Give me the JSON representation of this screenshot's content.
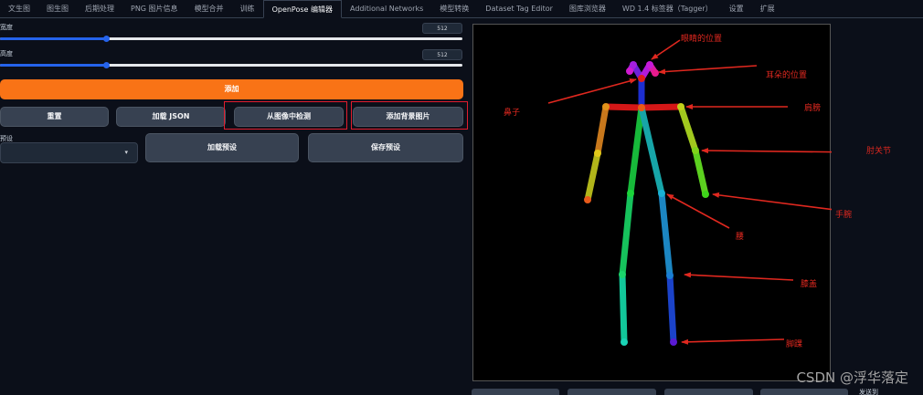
{
  "tabs": [
    {
      "label": "文生图"
    },
    {
      "label": "图生图"
    },
    {
      "label": "后期处理"
    },
    {
      "label": "PNG 图片信息"
    },
    {
      "label": "模型合并"
    },
    {
      "label": "训练"
    },
    {
      "label": "OpenPose 编辑器"
    },
    {
      "label": "Additional Networks"
    },
    {
      "label": "模型转换"
    },
    {
      "label": "Dataset Tag Editor"
    },
    {
      "label": "图库浏览器"
    },
    {
      "label": "WD 1.4 标签器（Tagger）"
    },
    {
      "label": "设置"
    },
    {
      "label": "扩展"
    }
  ],
  "active_tab_index": 6,
  "width": {
    "label": "宽度",
    "value": "512",
    "level": 0.23
  },
  "height": {
    "label": "高度",
    "value": "512",
    "level": 0.23
  },
  "buttons": {
    "add": "添加",
    "reset": "重置",
    "load_json": "加载 JSON",
    "detect_from_image": "从图像中检测",
    "add_background": "添加背景图片",
    "load_preset": "加载预设",
    "save_preset": "保存预设"
  },
  "preset": {
    "label": "预设",
    "value": ""
  },
  "annotations": {
    "eyes": "眼睛的位置",
    "ears": "耳朵的位置",
    "nose": "鼻子",
    "shoulder": "肩膀",
    "elbow": "肘关节",
    "wrist": "手腕",
    "hip": "腰",
    "knee": "膝盖",
    "ankle": "脚踝"
  },
  "bottom": {
    "send_to": "发送到"
  },
  "watermark": "CSDN @浮华落定",
  "colors": {
    "accent": "#f97316",
    "annotation": "#e0281f",
    "slider": "#2563eb"
  }
}
